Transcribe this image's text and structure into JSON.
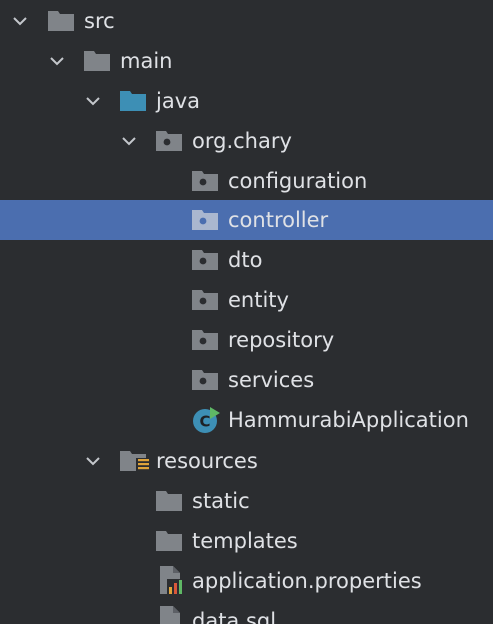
{
  "colors": {
    "background": "#2b2d30",
    "selection": "#4b6eaf",
    "text": "#dfe1e5",
    "folder": "#808489",
    "source_folder": "#3d8fb5",
    "class_icon": "#3d8fb5",
    "run_badge": "#5fb865"
  },
  "tree": {
    "nodes": [
      {
        "id": "src",
        "label": "src",
        "icon": "folder-icon",
        "expanded": true
      },
      {
        "id": "main",
        "label": "main",
        "icon": "folder-icon",
        "expanded": true
      },
      {
        "id": "java",
        "label": "java",
        "icon": "source-folder-icon",
        "expanded": true
      },
      {
        "id": "org-chary",
        "label": "org.chary",
        "icon": "package-icon",
        "expanded": true
      },
      {
        "id": "configuration",
        "label": "configuration",
        "icon": "package-icon"
      },
      {
        "id": "controller",
        "label": "controller",
        "icon": "package-icon",
        "selected": true
      },
      {
        "id": "dto",
        "label": "dto",
        "icon": "package-icon"
      },
      {
        "id": "entity",
        "label": "entity",
        "icon": "package-icon"
      },
      {
        "id": "repository",
        "label": "repository",
        "icon": "package-icon"
      },
      {
        "id": "services",
        "label": "services",
        "icon": "package-icon"
      },
      {
        "id": "hammurabi-application",
        "label": "HammurabiApplication",
        "icon": "spring-class-icon"
      },
      {
        "id": "resources",
        "label": "resources",
        "icon": "resources-folder-icon",
        "expanded": true
      },
      {
        "id": "static",
        "label": "static",
        "icon": "folder-icon"
      },
      {
        "id": "templates",
        "label": "templates",
        "icon": "folder-icon"
      },
      {
        "id": "application-properties",
        "label": "application.properties",
        "icon": "properties-file-icon"
      },
      {
        "id": "data-sql",
        "label": "data.sql",
        "icon": "sql-file-icon"
      }
    ]
  }
}
